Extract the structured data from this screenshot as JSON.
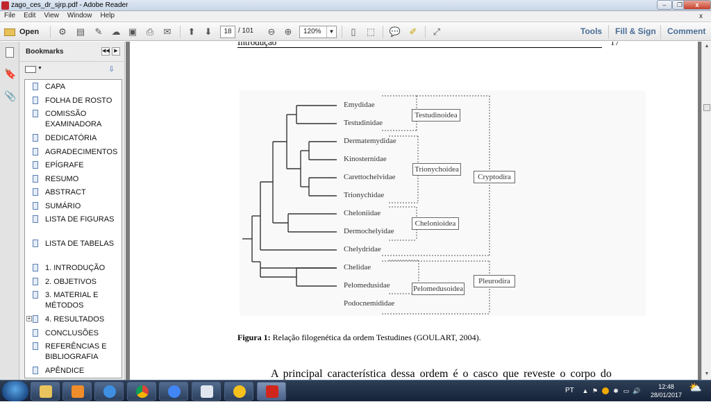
{
  "window": {
    "title": "zago_ces_dr_sjrp.pdf - Adobe Reader",
    "close_label": "x"
  },
  "menu": {
    "items": [
      "File",
      "Edit",
      "View",
      "Window",
      "Help"
    ],
    "close_doc": "x"
  },
  "toolbar": {
    "open_label": "Open",
    "page_current": "18",
    "page_total": "/ 101",
    "zoom": "120%",
    "tools_label": "Tools",
    "fill_sign_label": "Fill & Sign",
    "comment_label": "Comment"
  },
  "bookmarks": {
    "title": "Bookmarks",
    "items": [
      {
        "label": "CAPA"
      },
      {
        "label": "FOLHA DE ROSTO"
      },
      {
        "label": "COMISSÃO EXAMINADORA"
      },
      {
        "label": "DEDICATÓRIA"
      },
      {
        "label": "AGRADECIMENTOS"
      },
      {
        "label": "EPÍGRAFE"
      },
      {
        "label": "RESUMO"
      },
      {
        "label": "ABSTRACT"
      },
      {
        "label": "SUMÁRIO"
      },
      {
        "label": "LISTA DE FIGURAS"
      },
      {
        "label": "LISTA DE TABELAS"
      },
      {
        "label": "1. INTRODUÇÃO"
      },
      {
        "label": "2. OBJETIVOS"
      },
      {
        "label": "3. MATERIAL E MÉTODOS"
      },
      {
        "label": "4. RESULTADOS",
        "expandable": true
      },
      {
        "label": "CONCLUSÕES"
      },
      {
        "label": "REFERÊNCIAS E BIBLIOGRAFIA"
      },
      {
        "label": "APÊNDICE"
      }
    ]
  },
  "document": {
    "running_header": "Introdução",
    "page_number": "17",
    "figure": {
      "taxa": [
        "Emydidae",
        "Testudinidae",
        "Dermatemydidae",
        "Kinosternidae",
        "Carettochelvidae",
        "Trionychidae",
        "Cheloniidae",
        "Dermochelyidae",
        "Chelydridae",
        "Chelidae",
        "Pelomedusidae",
        "Podocnemididae"
      ],
      "superfamilies": [
        "Testudinoidea",
        "Trionychoidea",
        "Chelonioidea",
        "Pelomedusoidea"
      ],
      "suborders": [
        "Cryptodira",
        "Pleurodira"
      ]
    },
    "caption_label": "Figura 1:",
    "caption_text": " Relação filogenética da ordem Testudines (GOULART, 2004).",
    "body_text": "A principal característica dessa ordem é o casco que reveste o corpo do"
  },
  "taskbar": {
    "language": "PT",
    "time": "12:48",
    "date": "28/01/2017"
  }
}
